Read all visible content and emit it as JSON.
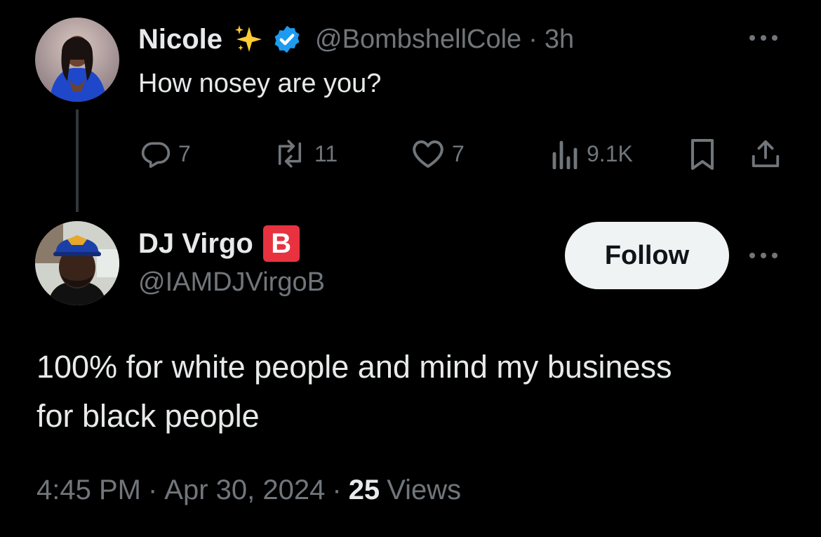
{
  "parent_post": {
    "author_name": "Nicole",
    "author_handle": "@BombshellCole",
    "separator": "·",
    "time": "3h",
    "text": "How nosey are you?",
    "verified_color": "#1d9bf0",
    "actions": {
      "replies": "7",
      "reposts": "11",
      "likes": "7",
      "views": "9.1K"
    }
  },
  "reply_post": {
    "author_name": "DJ Virgo",
    "author_handle": "@IAMDJVirgoB",
    "badge_letter": "B",
    "badge_color": "#e8323f",
    "follow_label": "Follow",
    "text_line1": "100% for white people and mind my business",
    "text_line2": "for black people",
    "meta": {
      "time": "4:45 PM",
      "date": "Apr 30, 2024",
      "separator": "·",
      "views_count": "25",
      "views_label": "Views"
    }
  },
  "icons": [
    "sparkles-icon",
    "verified-badge-icon",
    "more-icon",
    "reply-icon",
    "repost-icon",
    "like-icon",
    "views-icon",
    "bookmark-icon",
    "share-icon"
  ]
}
